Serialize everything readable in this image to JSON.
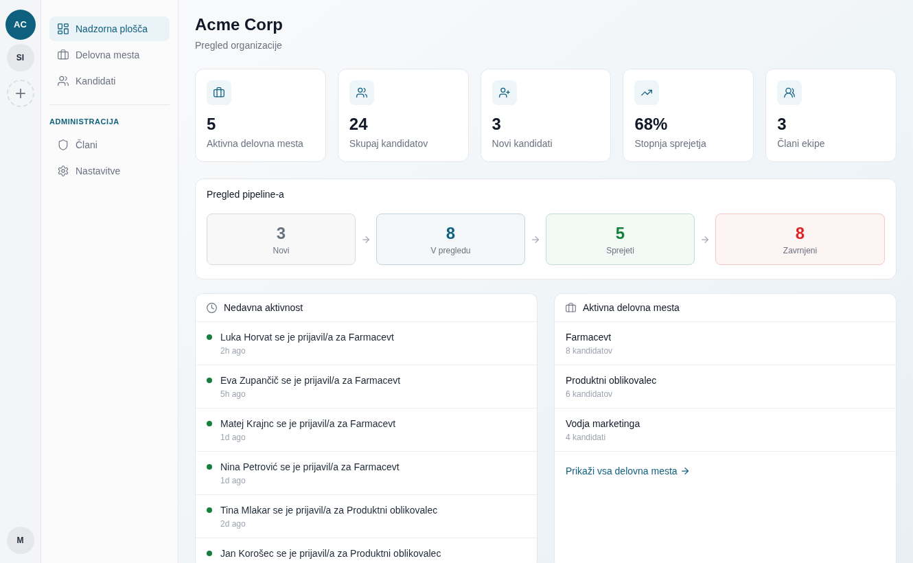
{
  "workspace_rail": {
    "workspaces": [
      {
        "initials": "AC",
        "selected": true
      },
      {
        "initials": "SI",
        "selected": false
      }
    ],
    "user": {
      "initials": "M"
    }
  },
  "sidebar": {
    "items": [
      {
        "label": "Nadzorna plošča",
        "selected": true
      },
      {
        "label": "Delovna mesta",
        "selected": false
      },
      {
        "label": "Kandidati",
        "selected": false
      }
    ],
    "sections": [
      {
        "heading": "ADMINISTRACIJA",
        "items": [
          {
            "label": "Člani",
            "selected": false
          },
          {
            "label": "Nastavitve",
            "selected": false
          }
        ]
      }
    ]
  },
  "header": {
    "title": "Acme Corp",
    "subtitle": "Pregled organizacije"
  },
  "stats": [
    {
      "value": "5",
      "label": "Aktivna delovna mesta"
    },
    {
      "value": "24",
      "label": "Skupaj kandidatov"
    },
    {
      "value": "3",
      "label": "Novi kandidati"
    },
    {
      "value": "68%",
      "label": "Stopnja sprejetja"
    },
    {
      "value": "3",
      "label": "Člani ekipe"
    }
  ],
  "pipeline": {
    "title": "Pregled pipeline-a",
    "stages": [
      {
        "count": "3",
        "label": "Novi",
        "color": "#6b7280"
      },
      {
        "count": "8",
        "label": "V pregledu",
        "color": "#0f5f7e"
      },
      {
        "count": "5",
        "label": "Sprejeti",
        "color": "#15803d"
      },
      {
        "count": "8",
        "label": "Zavrnjeni",
        "color": "#dc2626"
      }
    ]
  },
  "recent_activity": {
    "title": "Nedavna aktivnost",
    "items": [
      {
        "text": "Luka Horvat se je prijavil/a za Farmacevt",
        "time": "2h ago"
      },
      {
        "text": "Eva Zupančič se je prijavil/a za Farmacevt",
        "time": "5h ago"
      },
      {
        "text": "Matej Krajnc se je prijavil/a za Farmacevt",
        "time": "1d ago"
      },
      {
        "text": "Nina Petrović se je prijavil/a za Farmacevt",
        "time": "1d ago"
      },
      {
        "text": "Tina Mlakar se je prijavil/a za Produktni oblikovalec",
        "time": "2d ago"
      },
      {
        "text": "Jan Korošec se je prijavil/a za Produktni oblikovalec"
      }
    ]
  },
  "active_jobs": {
    "title": "Aktivna delovna mesta",
    "items": [
      {
        "title": "Farmacevt",
        "candidates": "8 kandidatov"
      },
      {
        "title": "Produktni oblikovalec",
        "candidates": "6 kandidatov"
      },
      {
        "title": "Vodja marketinga",
        "candidates": "4 kandidati"
      }
    ],
    "link": "Prikaži vsa delovna mesta"
  }
}
